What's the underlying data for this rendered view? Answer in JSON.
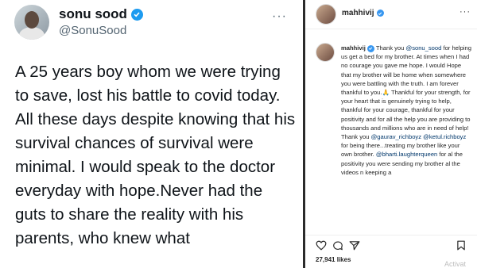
{
  "tweet": {
    "author_name": "sonu sood",
    "handle": "@SonuSood",
    "more_icon": "ellipsis-icon",
    "body": "A 25 years boy whom we were trying to save,  lost his battle to covid today. All these days despite knowing that his survival chances of survival were minimal. I would  speak to the doctor everyday with hope.Never had the guts to share the reality with his parents, who knew what"
  },
  "instagram": {
    "username": "mahhivij",
    "comment": {
      "username": "mahhivij",
      "seg1": " Thank you ",
      "m1": "@sonu_sood",
      "seg2": " for helping us get a bed for my brother. At times when I had no courage you gave me hope. I would Hope that my brother will be home when somewhere you were battling with the truth. I am forever thankful to you.",
      "emoji": "🙏",
      "seg3": " Thankful for your strength, for your heart that is genuinely trying to help, thankful for your courage, thankful for your positivity and for all the help you are providing to thousands and millions who are in need of help! Thank you ",
      "m2": "@gaurav_richboyz",
      "seg4": " ",
      "m3": "@ketul.richboyz",
      "seg5": " for being there...treating my brother like your own brother. ",
      "m4": "@bharti.laughterqueen",
      "seg6": " for al the positivity you were sending my brother al the videos n keeping a"
    },
    "likes": "27,941 likes",
    "overlay_text": "Activat"
  },
  "colors": {
    "twitter_verified": "#1d9bf0",
    "instagram_verified": "#3897f0",
    "mention": "#00376b"
  }
}
